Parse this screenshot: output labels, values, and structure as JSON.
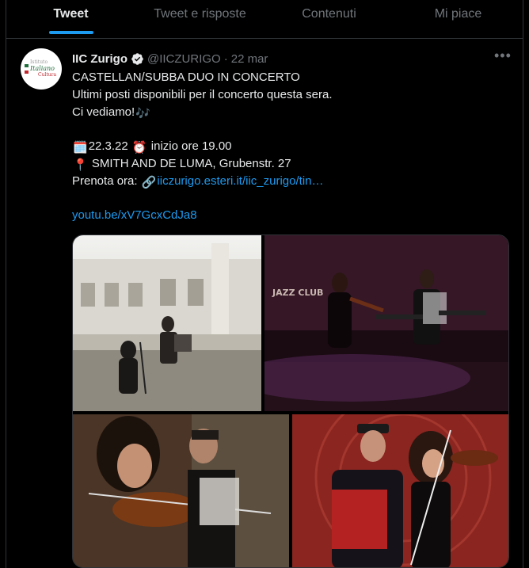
{
  "tabs": [
    {
      "label": "Tweet",
      "active": true
    },
    {
      "label": "Tweet e risposte",
      "active": false
    },
    {
      "label": "Contenuti",
      "active": false
    },
    {
      "label": "Mi piace",
      "active": false
    }
  ],
  "tweet": {
    "name": "IIC Zurigo",
    "handle": "@IICZURIGO",
    "separator": "·",
    "date": "22 mar",
    "more_label": "•••",
    "avatar_text": {
      "line1": "Istituto",
      "line2": "Italiano",
      "line3": "Cultura"
    },
    "lines": {
      "l1": "CASTELLAN/SUBBA DUO IN CONCERTO",
      "l2": "Ultimi posti disponibili per il concerto questa sera.",
      "l3": "Ci vediamo!",
      "l4": "22.3.22",
      "l4b": "inizio ore 19.00",
      "l5": "SMITH AND DE LUMA, Grubenstr. 27",
      "l6_prefix": "Prenota ora:",
      "l6_link": "iiczurigo.esteri.it/iic_zurigo/tin…",
      "l7_link": "youtu.be/xV7GcxCdJa8"
    },
    "emoji": {
      "music": "🎶",
      "calendar": "🗓️",
      "alarm": "⏰",
      "pin": "📍",
      "link": "🔗"
    },
    "photo_sign": "JAZZ CLUB",
    "colors": {
      "accent": "#1d9bf0",
      "text": "#e7e9ea",
      "muted": "#71767b",
      "border": "#2f3336"
    }
  }
}
